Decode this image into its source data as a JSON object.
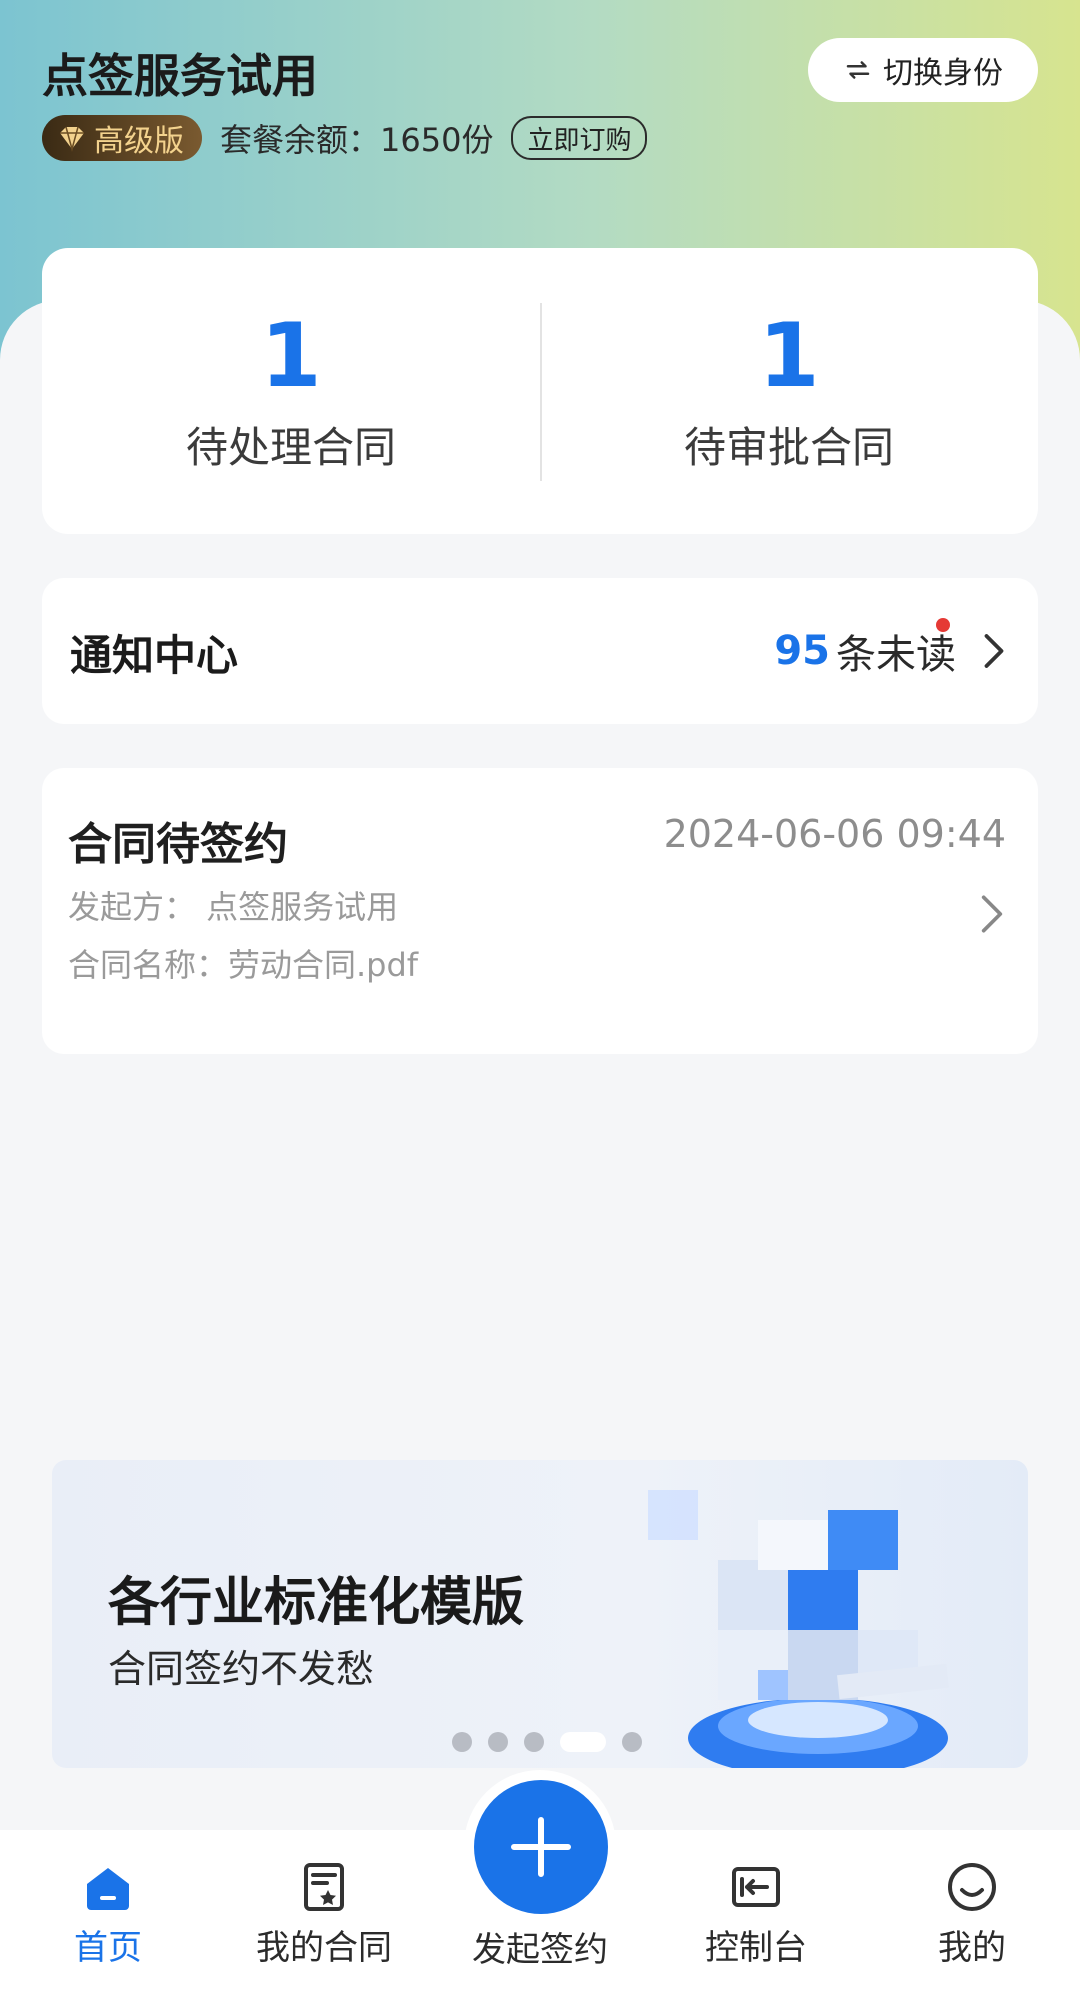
{
  "header": {
    "title": "点签服务试用",
    "switch_label": "切换身份",
    "plan_badge": "高级版",
    "balance_text": "套餐余额：1650份",
    "order_button": "立即订购"
  },
  "stats": [
    {
      "value": "1",
      "label": "待处理合同"
    },
    {
      "value": "1",
      "label": "待审批合同"
    }
  ],
  "notice": {
    "title": "通知中心",
    "count": "95",
    "suffix": "条未读"
  },
  "contract": {
    "title": "合同待签约",
    "time": "2024-06-06 09:44",
    "initiator": "发起方：  点签服务试用",
    "name": "合同名称：劳动合同.pdf"
  },
  "banner": {
    "headline": "各行业标准化模版",
    "subline": "合同签约不发愁",
    "active_index": 3,
    "total": 5
  },
  "tabs": [
    {
      "label": "首页",
      "icon": "home-icon",
      "active": true
    },
    {
      "label": "我的合同",
      "icon": "contract-icon",
      "active": false
    },
    {
      "label": "发起签约",
      "icon": "plus-icon",
      "active": false
    },
    {
      "label": "控制台",
      "icon": "console-icon",
      "active": false
    },
    {
      "label": "我的",
      "icon": "smile-icon",
      "active": false
    }
  ],
  "colors": {
    "accent": "#1a73e8",
    "red_dot": "#e53935",
    "badge_text": "#f3d28d"
  }
}
